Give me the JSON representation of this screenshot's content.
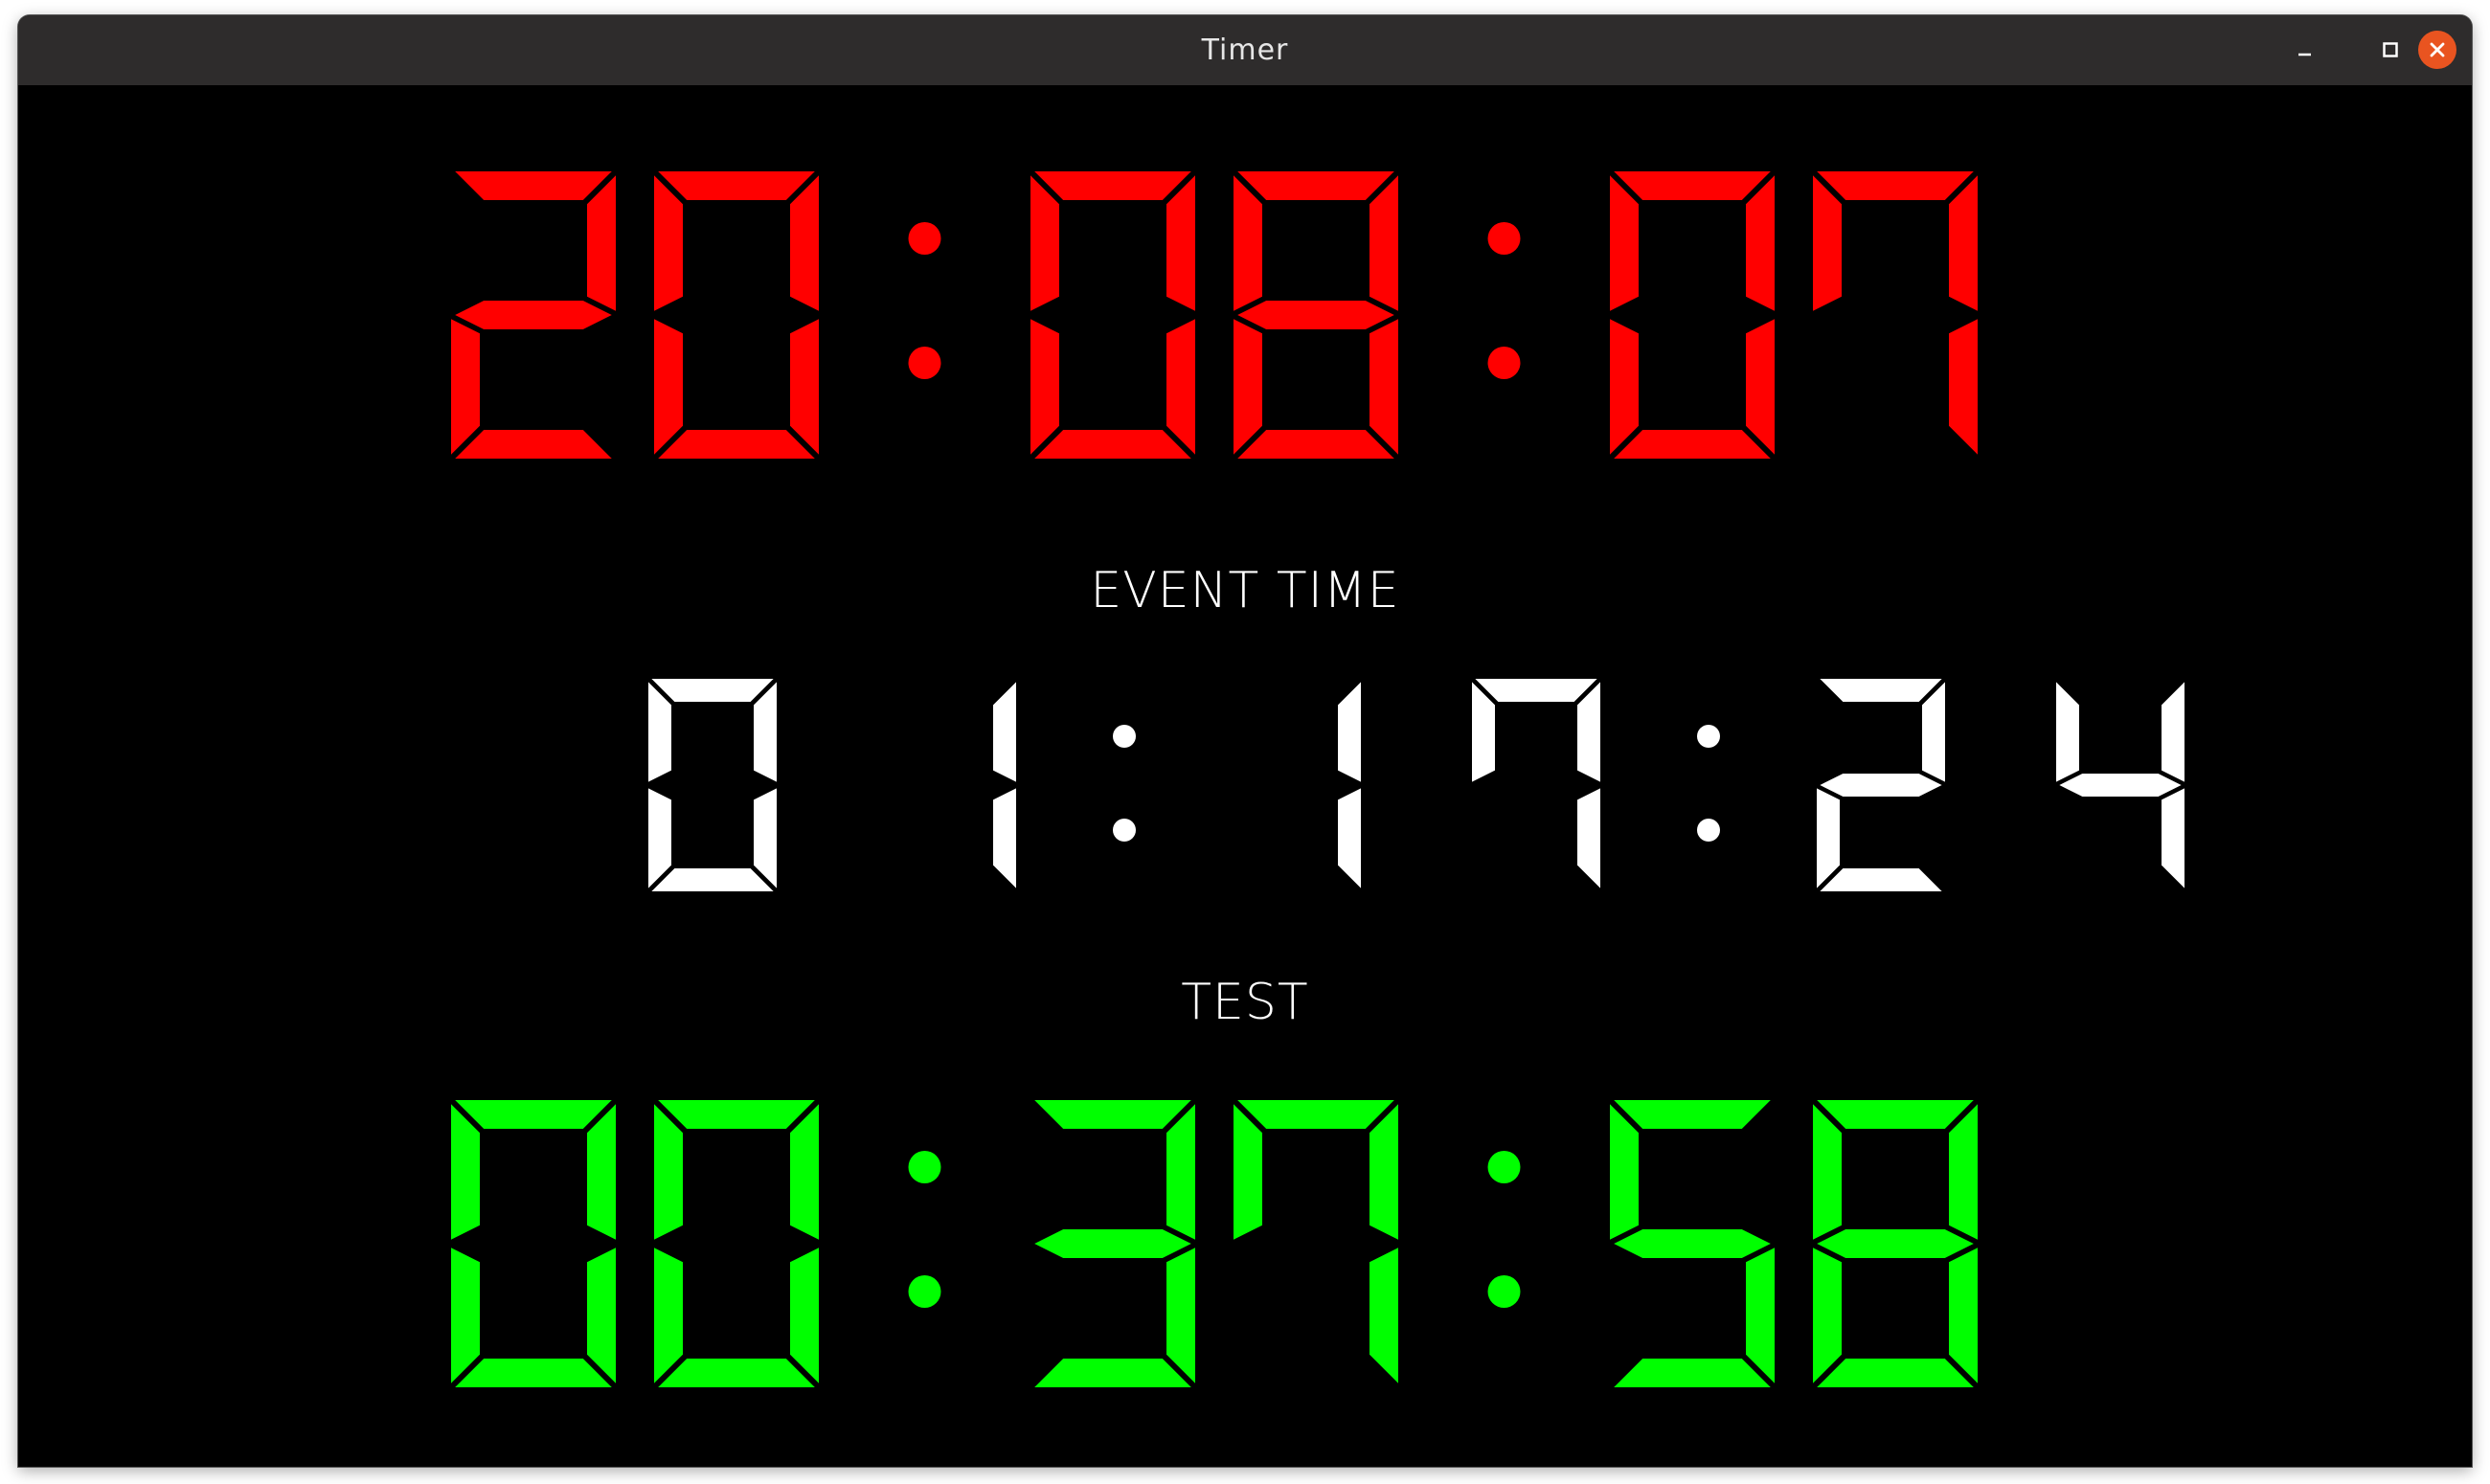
{
  "window": {
    "title": "Timer",
    "controls": {
      "minimize_icon": "minimize-icon",
      "maximize_icon": "maximize-icon",
      "close_icon": "close-icon",
      "close_color": "#e95420"
    }
  },
  "clocks": {
    "current": {
      "value": "20:08:07",
      "color": "#ff0000"
    },
    "event": {
      "label": "EVENT TIME",
      "value": "01:17:24",
      "color": "#ffffff"
    },
    "test": {
      "label": "TEST",
      "value": "00:37:58",
      "color": "#00ff00"
    }
  },
  "background_color": "#000000"
}
